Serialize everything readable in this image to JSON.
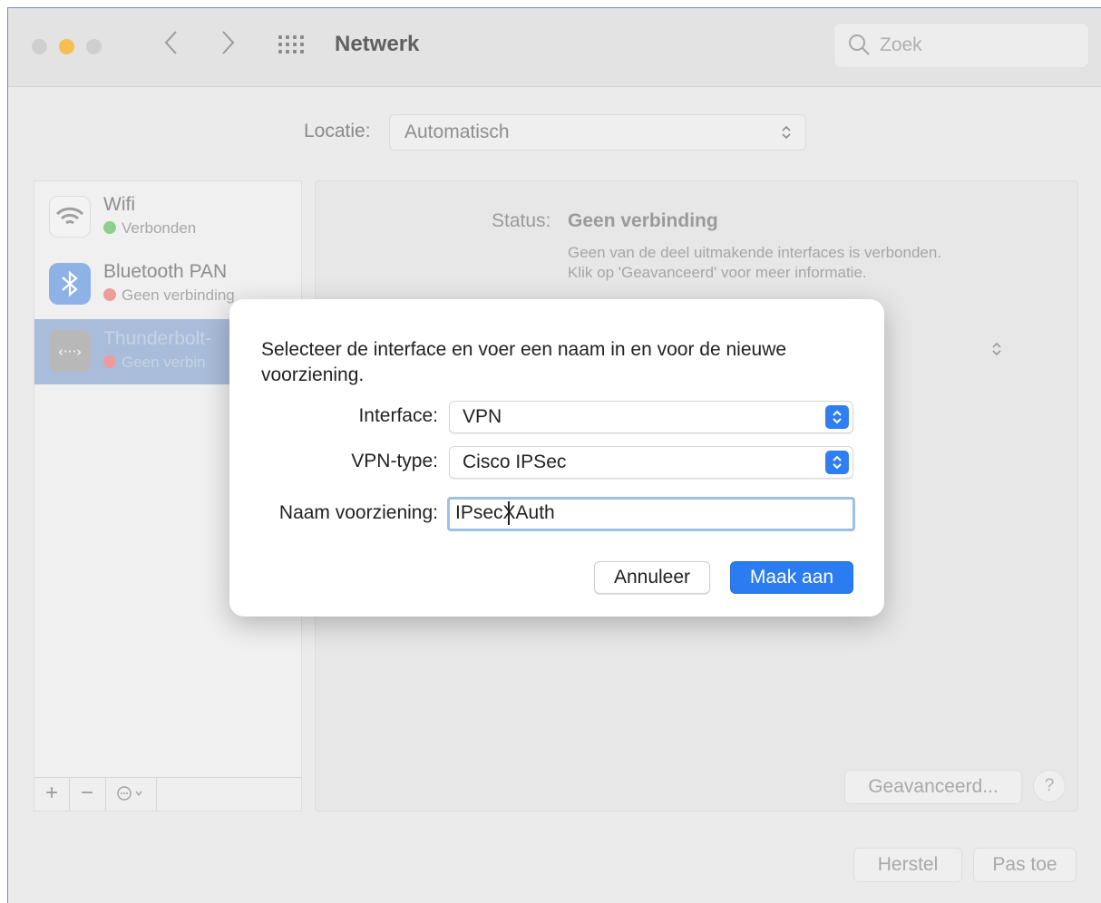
{
  "window": {
    "title": "Netwerk",
    "search_placeholder": "Zoek"
  },
  "location": {
    "label": "Locatie:",
    "value": "Automatisch"
  },
  "sidebar": {
    "services": [
      {
        "name": "Wifi",
        "status": "Verbonden",
        "status_color": "#8ccf8c",
        "icon": "wifi-icon"
      },
      {
        "name": "Bluetooth PAN",
        "status": "Geen verbinding",
        "status_color": "#ee9b9b",
        "icon": "bluetooth-icon"
      },
      {
        "name": "Thunderbolt-",
        "status": "Geen verbin",
        "status_color": "#ee9b9b",
        "icon": "thunderbolt-icon"
      }
    ],
    "toolbar": {
      "add": "+",
      "remove": "−",
      "action_icon": "ellipsis-circle-icon"
    }
  },
  "detail": {
    "status_label": "Status:",
    "status_value": "Geen verbinding",
    "status_description": "Geen van de deel uitmakende interfaces is verbonden. Klik op 'Geavanceerd' voor meer informatie.",
    "advanced_button": "Geavanceerd...",
    "help_button": "?",
    "revert_button": "Herstel",
    "apply_button": "Pas toe"
  },
  "dialog": {
    "message": "Selecteer de interface en voer een naam in en voor de nieuwe voorziening.",
    "interface_label": "Interface:",
    "interface_value": "VPN",
    "vpn_type_label": "VPN-type:",
    "vpn_type_value": "Cisco IPSec",
    "service_name_label": "Naam voorziening:",
    "service_name_value": "IPsecXAuth",
    "cancel_button": "Annuleer",
    "create_button": "Maak aan",
    "accent_color": "#2a7cf0"
  }
}
